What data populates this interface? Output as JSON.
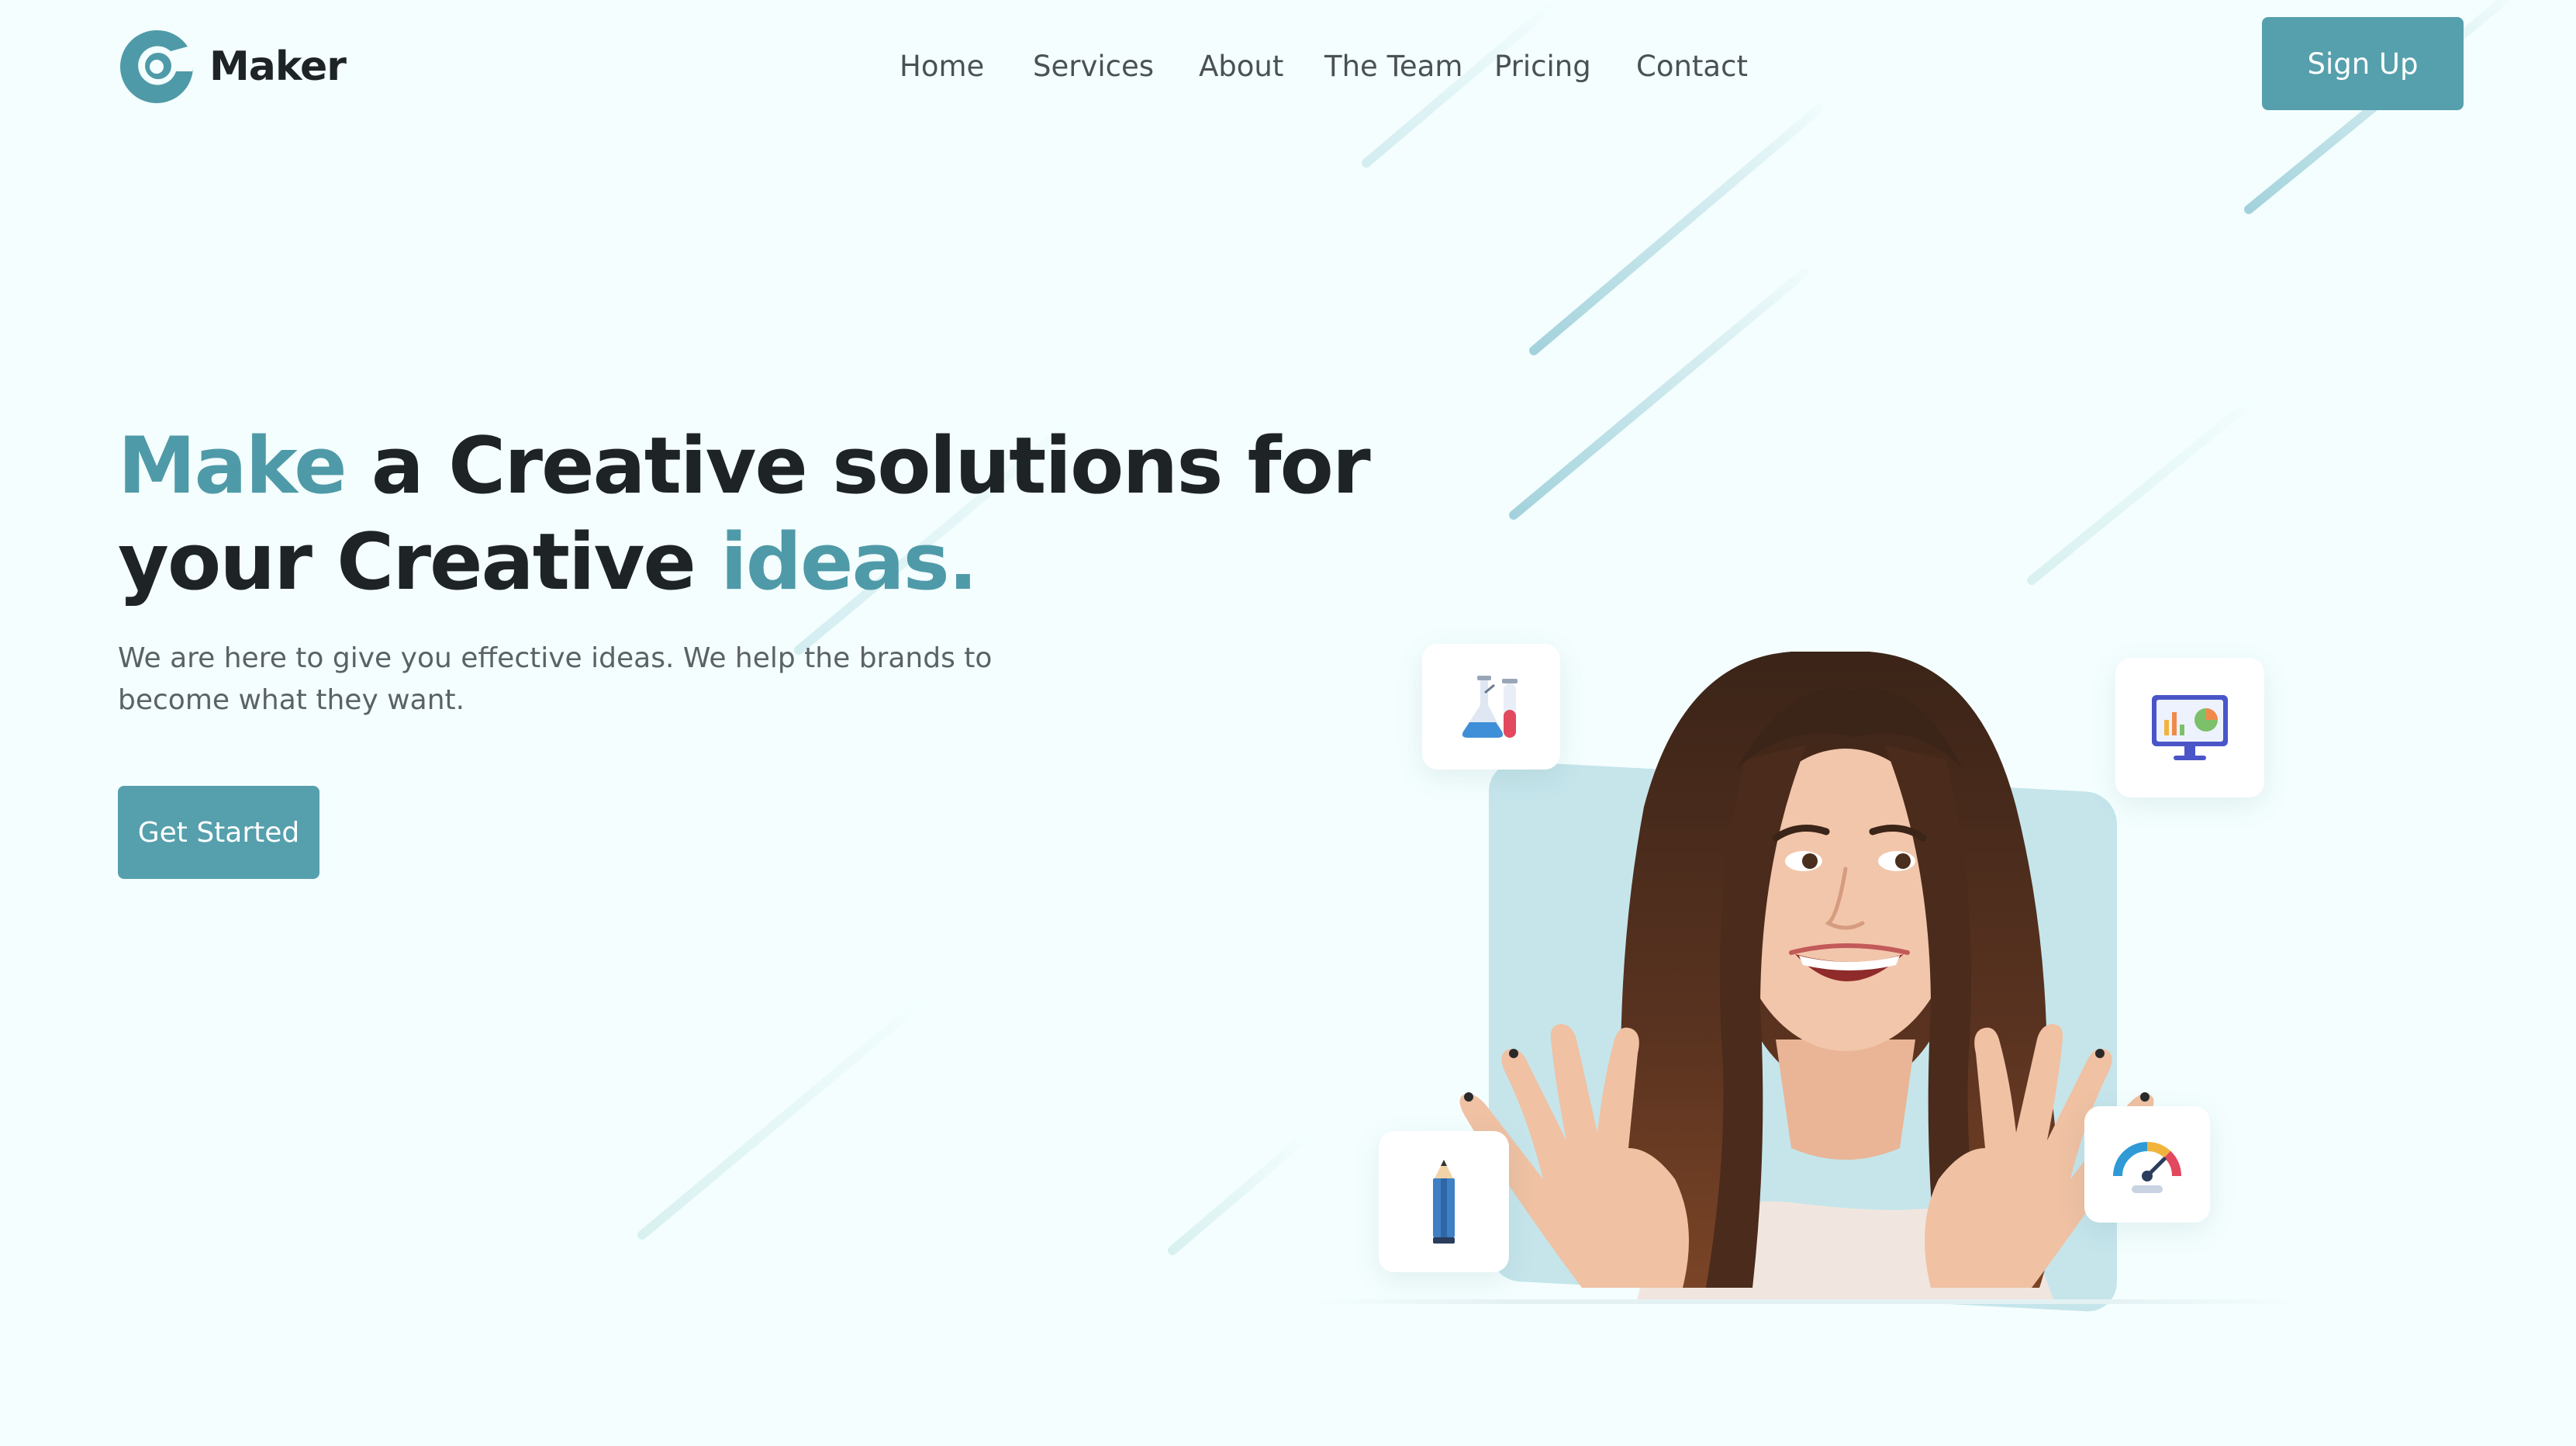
{
  "brand": {
    "name": "Maker",
    "logo_icon": "logo-mark-icon"
  },
  "nav": {
    "items": [
      "Home",
      "Services",
      "About",
      "The Team",
      "Pricing",
      "Contact"
    ]
  },
  "header": {
    "signup_label": "Sign Up"
  },
  "hero": {
    "title_accent_1": "Make",
    "title_middle_1": " a Creative solutions for",
    "title_middle_2": "your Creative ",
    "title_accent_2": "ideas.",
    "description": "We are here to give you effective ideas. We help the brands to become what they want.",
    "cta_label": "Get Started"
  },
  "illustration": {
    "subject": "smiling woman with raised hands",
    "floating_icons": [
      "lab-flask-icon",
      "presentation-monitor-icon",
      "pencil-icon",
      "speedometer-icon"
    ]
  },
  "colors": {
    "accent": "#55a0ac",
    "heading_accent": "#4f9aa8",
    "background": "#f4fefe",
    "backdrop": "#c5e5eb",
    "text_dark": "#1e2326",
    "text_muted": "#5a6266"
  }
}
